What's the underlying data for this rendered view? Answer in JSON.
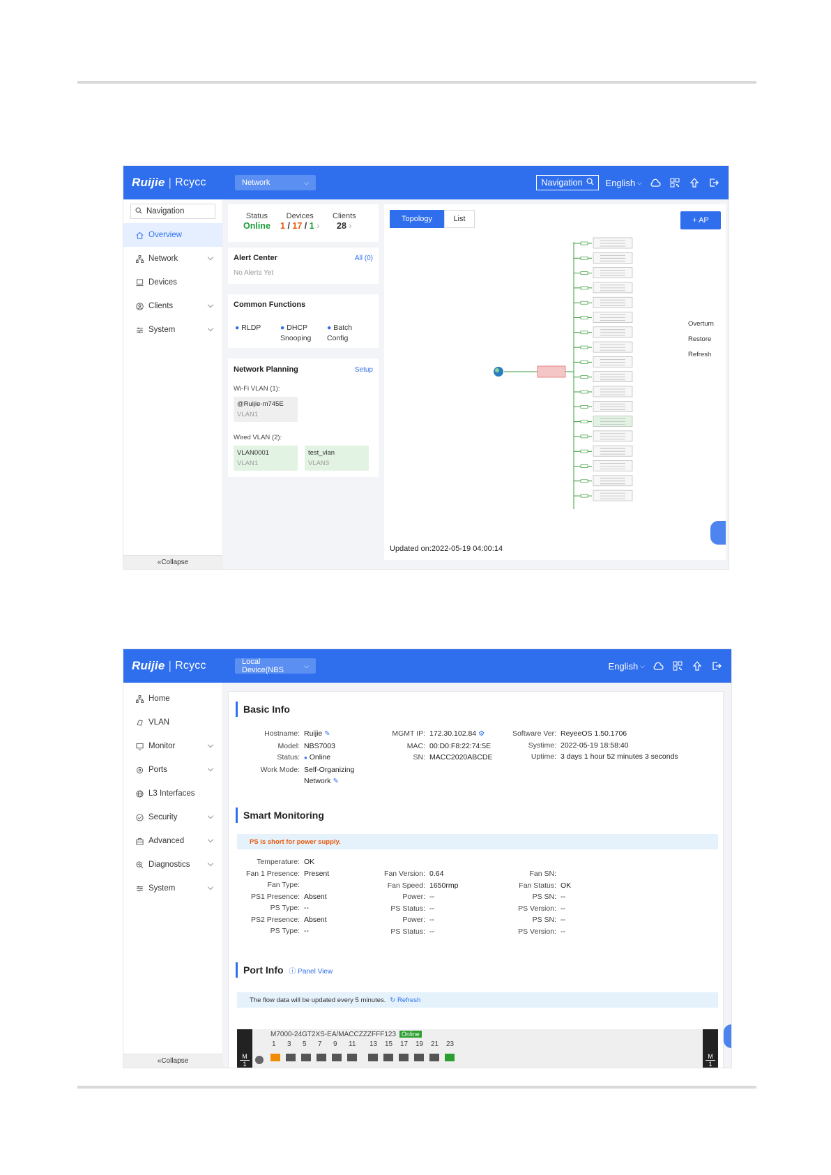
{
  "shot1": {
    "logo": {
      "brand": "Ruijie",
      "sub": "Rcycc"
    },
    "network_select": "Network",
    "top": {
      "navigation": "Navigation",
      "language": "English"
    },
    "sidebar": {
      "nav_search": "Navigation",
      "items": [
        {
          "label": "Overview",
          "icon": "home-icon",
          "active": true
        },
        {
          "label": "Network",
          "icon": "network-icon",
          "chevron": true
        },
        {
          "label": "Devices",
          "icon": "devices-icon"
        },
        {
          "label": "Clients",
          "icon": "clients-icon",
          "chevron": true
        },
        {
          "label": "System",
          "icon": "system-icon",
          "chevron": true
        }
      ],
      "collapse": "Collapse"
    },
    "stats": {
      "status_label": "Status",
      "status_value": "Online",
      "devices_label": "Devices",
      "devices_a": "1",
      "devices_b": "17",
      "devices_c": "1",
      "clients_label": "Clients",
      "clients_value": "28"
    },
    "alert": {
      "title": "Alert Center",
      "link": "All (0)",
      "empty": "No Alerts Yet"
    },
    "functions": {
      "title": "Common Functions",
      "items": [
        {
          "line1": "RLDP",
          "line2": ""
        },
        {
          "line1": "DHCP",
          "line2": "Snooping"
        },
        {
          "line1": "Batch",
          "line2": "Config"
        }
      ]
    },
    "planning": {
      "title": "Network Planning",
      "link": "Setup",
      "wifi_label": "Wi-Fi VLAN (1):",
      "wifi": [
        {
          "name": "@Ruijie-m745E",
          "vlan": "VLAN1"
        }
      ],
      "wired_label": "Wired VLAN (2):",
      "wired": [
        {
          "name": "VLAN0001",
          "vlan": "VLAN1"
        },
        {
          "name": "test_vlan",
          "vlan": "VLAN3"
        }
      ]
    },
    "topology": {
      "tabs": [
        "Topology",
        "List"
      ],
      "add_button": "+ AP",
      "side_actions": [
        "Overturn",
        "Restore",
        "Refresh"
      ],
      "updated": "Updated on:2022-05-19 04:00:14"
    }
  },
  "shot2": {
    "logo": {
      "brand": "Ruijie",
      "sub": "Rcycc"
    },
    "device_select": "Local Device(NBS",
    "top": {
      "language": "English"
    },
    "sidebar": {
      "items": [
        {
          "label": "Home",
          "icon": "home-network-icon"
        },
        {
          "label": "VLAN",
          "icon": "vlan-icon"
        },
        {
          "label": "Monitor",
          "icon": "monitor-icon",
          "chevron": true
        },
        {
          "label": "Ports",
          "icon": "ports-icon",
          "chevron": true
        },
        {
          "label": "L3 Interfaces",
          "icon": "globe-icon"
        },
        {
          "label": "Security",
          "icon": "shield-icon",
          "chevron": true
        },
        {
          "label": "Advanced",
          "icon": "advanced-icon",
          "chevron": true
        },
        {
          "label": "Diagnostics",
          "icon": "diagnostics-icon",
          "chevron": true
        },
        {
          "label": "System",
          "icon": "system-icon",
          "chevron": true
        }
      ],
      "collapse": "Collapse"
    },
    "basic": {
      "title": "Basic Info",
      "hostname_k": "Hostname:",
      "hostname_v": "Ruijie",
      "model_k": "Model:",
      "model_v": "NBS7003",
      "status_k": "Status:",
      "status_v": "Online",
      "mode_k": "Work Mode:",
      "mode_v1": "Self-Organizing",
      "mode_v2": "Network",
      "ip_k": "MGMT IP:",
      "ip_v": "172.30.102.84",
      "mac_k": "MAC:",
      "mac_v": "00:D0:F8:22:74:5E",
      "sn_k": "SN:",
      "sn_v": "MACC2020ABCDE",
      "sw_k": "Software Ver:",
      "sw_v": "ReyeeOS 1.50.1706",
      "time_k": "Systime:",
      "time_v": "2022-05-19 18:58:40",
      "up_k": "Uptime:",
      "up_v": "3 days 1 hour 52 minutes 3 seconds"
    },
    "smart": {
      "title": "Smart Monitoring",
      "banner": "PS is short for power supply.",
      "col1": [
        {
          "k": "Temperature:",
          "v": "OK",
          "c": "green"
        },
        {
          "k": "Fan 1 Presence:",
          "v": "Present",
          "c": "green"
        },
        {
          "k": "Fan Type:",
          "v": "",
          "c": ""
        },
        {
          "k": "PS1 Presence:",
          "v": "Absent",
          "c": "red"
        },
        {
          "k": "PS Type:",
          "v": "--",
          "c": ""
        },
        {
          "k": "PS2 Presence:",
          "v": "Absent",
          "c": "red"
        },
        {
          "k": "PS Type:",
          "v": "--",
          "c": ""
        }
      ],
      "col2": [
        {
          "k": "Fan Version:",
          "v": "0.64",
          "c": ""
        },
        {
          "k": "Fan Speed:",
          "v": "1650rmp",
          "c": ""
        },
        {
          "k": "Power:",
          "v": "--",
          "c": ""
        },
        {
          "k": "PS Status:",
          "v": "--",
          "c": ""
        },
        {
          "k": "Power:",
          "v": "--",
          "c": ""
        },
        {
          "k": "PS Status:",
          "v": "--",
          "c": ""
        }
      ],
      "col3": [
        {
          "k": "Fan SN:",
          "v": "",
          "c": ""
        },
        {
          "k": "Fan Status:",
          "v": "OK",
          "c": "green"
        },
        {
          "k": "PS SN:",
          "v": "--",
          "c": ""
        },
        {
          "k": "PS Version:",
          "v": "--",
          "c": ""
        },
        {
          "k": "PS SN:",
          "v": "--",
          "c": ""
        },
        {
          "k": "PS Version:",
          "v": "--",
          "c": ""
        }
      ]
    },
    "port": {
      "title": "Port Info",
      "panel_link": "Panel View",
      "banner": "The flow data will be updated every 5 minutes.",
      "refresh": "Refresh",
      "device_name": "M7000-24GT2XS-EA/MACCZZZFFF123",
      "device_status": "Online",
      "numbers": [
        "1",
        "3",
        "5",
        "7",
        "9",
        "11",
        "13",
        "15",
        "17",
        "19",
        "21",
        "23"
      ],
      "slot_label": "M",
      "slot_num": "1"
    }
  }
}
